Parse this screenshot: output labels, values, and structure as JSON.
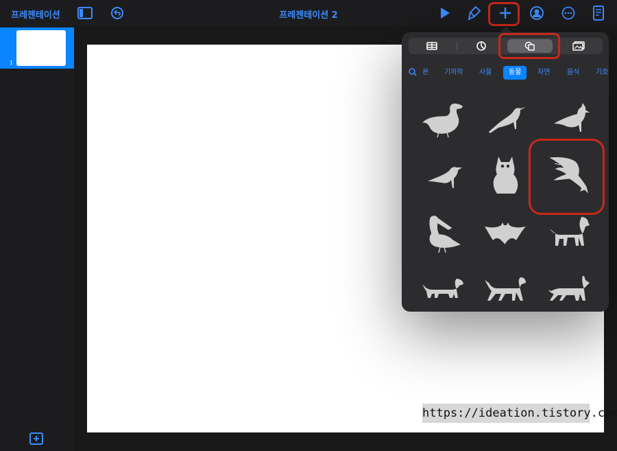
{
  "app": {
    "doc_list_label": "프레젠테이션",
    "title": "프레젠테이션 2"
  },
  "slides": [
    {
      "number": "1"
    }
  ],
  "insert_popover": {
    "selected_tab": "shapes",
    "search_label": "본",
    "categories": [
      "기하학",
      "사물",
      "동물",
      "자연",
      "음식",
      "기호"
    ],
    "selected_category": "동물",
    "shapes": [
      {
        "name": "duck-shape"
      },
      {
        "name": "crow-shape"
      },
      {
        "name": "cardinal-shape"
      },
      {
        "name": "raven-shape"
      },
      {
        "name": "owl-shape"
      },
      {
        "name": "eagle-shape"
      },
      {
        "name": "pelican-shape"
      },
      {
        "name": "bat-shape"
      },
      {
        "name": "dog-shape"
      },
      {
        "name": "dachshund-shape"
      },
      {
        "name": "hound-shape"
      },
      {
        "name": "wolf-shape"
      }
    ]
  },
  "watermark": "https://ideation.tistory.com",
  "colors": {
    "accent": "#0a84ff",
    "link": "#3d8bff",
    "highlight": "#c8281c",
    "toolbar_bg": "#1c1c1e",
    "popover_bg": "#2c2c2e",
    "shape_fill": "#d0d0d0"
  }
}
